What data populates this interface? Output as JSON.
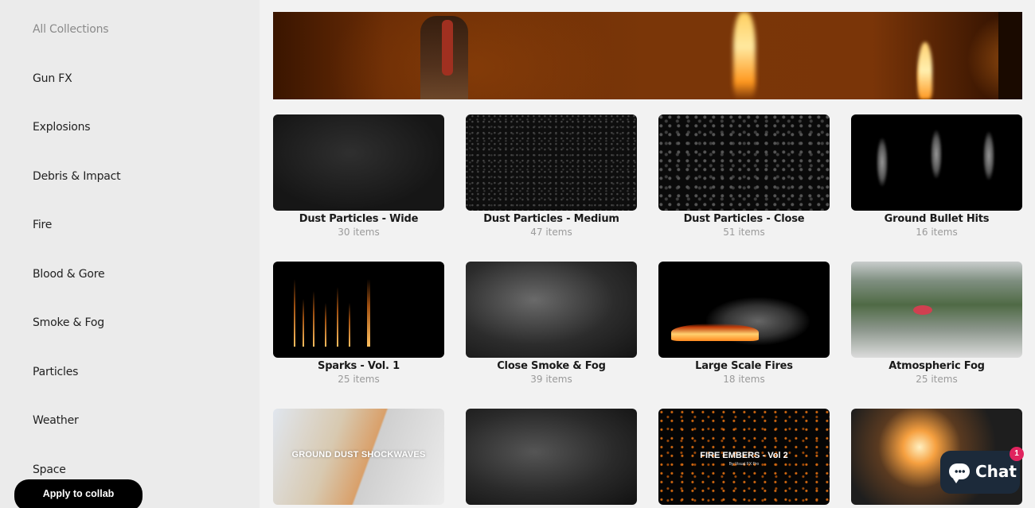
{
  "sidebar": {
    "items": [
      {
        "label": "All Collections",
        "active": false
      },
      {
        "label": "Gun FX"
      },
      {
        "label": "Explosions"
      },
      {
        "label": "Debris & Impact"
      },
      {
        "label": "Fire"
      },
      {
        "label": "Blood & Gore"
      },
      {
        "label": "Smoke & Fog"
      },
      {
        "label": "Particles"
      },
      {
        "label": "Weather"
      },
      {
        "label": "Space"
      }
    ],
    "apply_button": "Apply to collab"
  },
  "hero": {
    "image": "firefighter-in-burning-forest"
  },
  "collections": [
    {
      "title": "Dust Particles - Wide",
      "count": "30 items"
    },
    {
      "title": "Dust Particles - Medium",
      "count": "47 items"
    },
    {
      "title": "Dust Particles - Close",
      "count": "51 items"
    },
    {
      "title": "Ground Bullet Hits",
      "count": "16 items"
    },
    {
      "title": "Sparks - Vol. 1",
      "count": "25 items"
    },
    {
      "title": "Close Smoke & Fog",
      "count": "39 items"
    },
    {
      "title": "Large Scale Fires",
      "count": "18 items"
    },
    {
      "title": "Atmospheric Fog",
      "count": "25 items"
    },
    {
      "title": "",
      "count": "",
      "thumb_text": "GROUND DUST SHOCKWAVES"
    },
    {
      "title": "",
      "count": ""
    },
    {
      "title": "",
      "count": "",
      "thumb_text": "FIRE EMBERS - Vol 2",
      "thumb_subtext": "By Visual FX Pro"
    },
    {
      "title": "",
      "count": ""
    }
  ],
  "chat": {
    "label": "Chat",
    "badge": "1",
    "bg_color": "#1c2a3a",
    "badge_color": "#e0245e"
  }
}
